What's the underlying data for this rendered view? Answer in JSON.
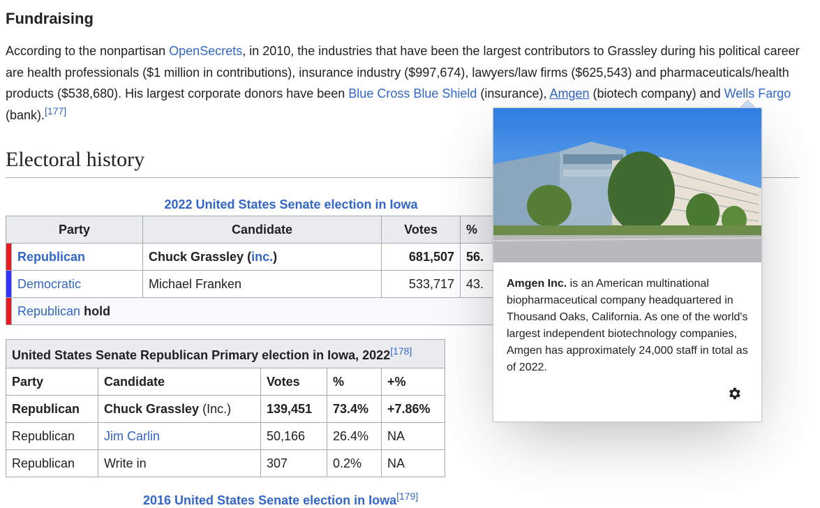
{
  "fundraising": {
    "heading": "Fundraising",
    "p_before_opensecrets": "According to the nonpartisan ",
    "opensecrets_link": "OpenSecrets",
    "p_mid1": ", in 2010, the industries that have been the largest contributors to Grassley during his political career are health professionals ($1 million in contributions), insurance industry ($997,674), lawyers/law firms ($625,543) and pharmaceuticals/health products ($538,680). His largest corporate donors have been ",
    "bcbs_link": "Blue Cross Blue Shield",
    "p_mid2": " (insurance), ",
    "amgen_link": "Amgen",
    "p_mid3": " (biotech company) and ",
    "wells_link": "Wells Fargo",
    "p_end": " (bank).",
    "ref": "[177]"
  },
  "electoral_history": {
    "heading": "Electoral history",
    "table1": {
      "caption": "2022 United States Senate election in Iowa",
      "headers": [
        "Party",
        "Candidate",
        "Votes",
        "%"
      ],
      "rows": [
        {
          "color": "#e81b23",
          "party": "Republican",
          "candidate": "Chuck Grassley",
          "candidate_suffix_pre": " (",
          "inc_link": "inc.",
          "candidate_suffix_post": ")",
          "votes": "681,507",
          "pct": "56."
        },
        {
          "color": "#3333ff",
          "party": "Democratic",
          "candidate": "Michael Franken",
          "votes": "533,717",
          "pct": "43."
        }
      ],
      "hold": {
        "color": "#e81b23",
        "party": "Republican",
        "word": "hold"
      }
    },
    "table2": {
      "caption": "United States Senate Republican Primary election in Iowa, 2022",
      "caption_ref": "[178]",
      "headers": [
        "Party",
        "Candidate",
        "Votes",
        "%",
        "+%"
      ],
      "rows": [
        {
          "party": "Republican",
          "candidate": "Chuck Grassley",
          "candidate_suffix": " (Inc.)",
          "votes": "139,451",
          "pct": "73.4%",
          "change": "+7.86%"
        },
        {
          "party": "Republican",
          "candidate": "Jim Carlin",
          "votes": "50,166",
          "pct": "26.4%",
          "change": "NA"
        },
        {
          "party": "Republican",
          "candidate": "Write in",
          "votes": "307",
          "pct": "0.2%",
          "change": "NA"
        }
      ]
    },
    "table3_caption": "2016 United States Senate election in Iowa",
    "table3_ref": "[179]"
  },
  "popup": {
    "title_bold": "Amgen Inc.",
    "extract": " is an American multinational biopharmaceutical company headquartered in Thousand Oaks, California. As one of the world's largest independent biotechnology companies, Amgen has approximately 24,000 staff in total as of 2022.",
    "settings_icon": "gear-icon"
  }
}
